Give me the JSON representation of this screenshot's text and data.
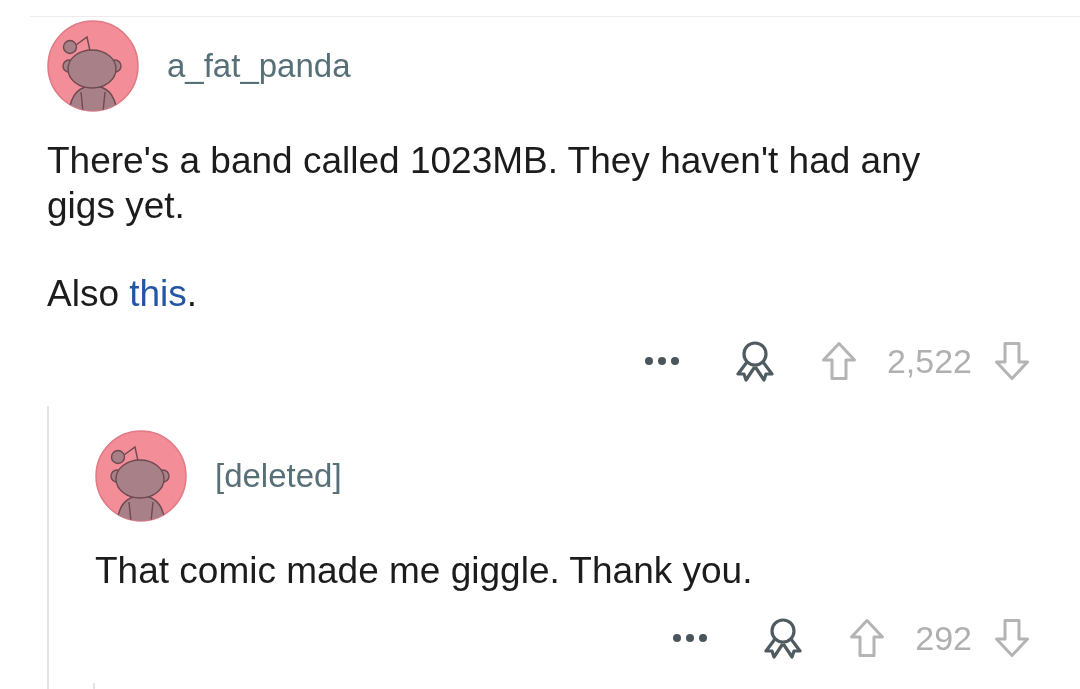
{
  "comment": {
    "author": "a_fat_panda",
    "paragraphs": [
      [
        {
          "kind": "text",
          "text": "There's a band called 1023MB. They haven't had any gigs yet."
        }
      ],
      [
        {
          "kind": "text",
          "text": "Also "
        },
        {
          "kind": "link",
          "text": "this"
        },
        {
          "kind": "text",
          "text": "."
        }
      ]
    ],
    "score": "2,522",
    "replies": [
      {
        "author": "[deleted]",
        "paragraphs": [
          [
            {
              "kind": "text",
              "text": "That comic made me giggle. Thank you."
            }
          ]
        ],
        "score": "292"
      }
    ]
  }
}
